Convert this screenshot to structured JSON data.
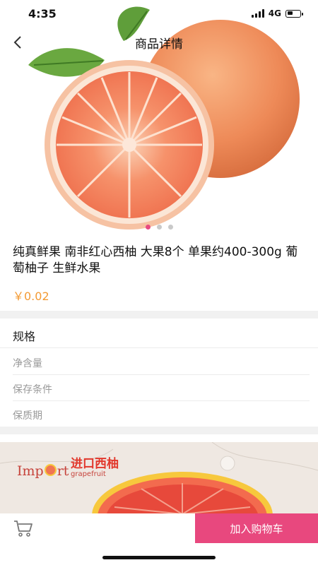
{
  "status": {
    "time": "4:35",
    "network": "4G"
  },
  "nav": {
    "title": "商品详情"
  },
  "gallery": {
    "image": "grapefruit-photo",
    "slide_count": 3,
    "active_slide": 1
  },
  "product": {
    "title": "纯真鲜果 南非红心西柚 大果8个 单果约400-300g 葡萄柚子 生鲜水果",
    "price": "￥0.02"
  },
  "specs": {
    "header": "规格",
    "rows": [
      "净含量",
      "保存条件",
      "保质期"
    ]
  },
  "banner": {
    "imp_text": "Imp",
    "ort_text": "rt",
    "title": "进口西柚",
    "subtitle": "grapefruit"
  },
  "bottom": {
    "add_to_cart": "加入购物车"
  },
  "colors": {
    "accent": "#e8487e",
    "price": "#f39a33"
  }
}
